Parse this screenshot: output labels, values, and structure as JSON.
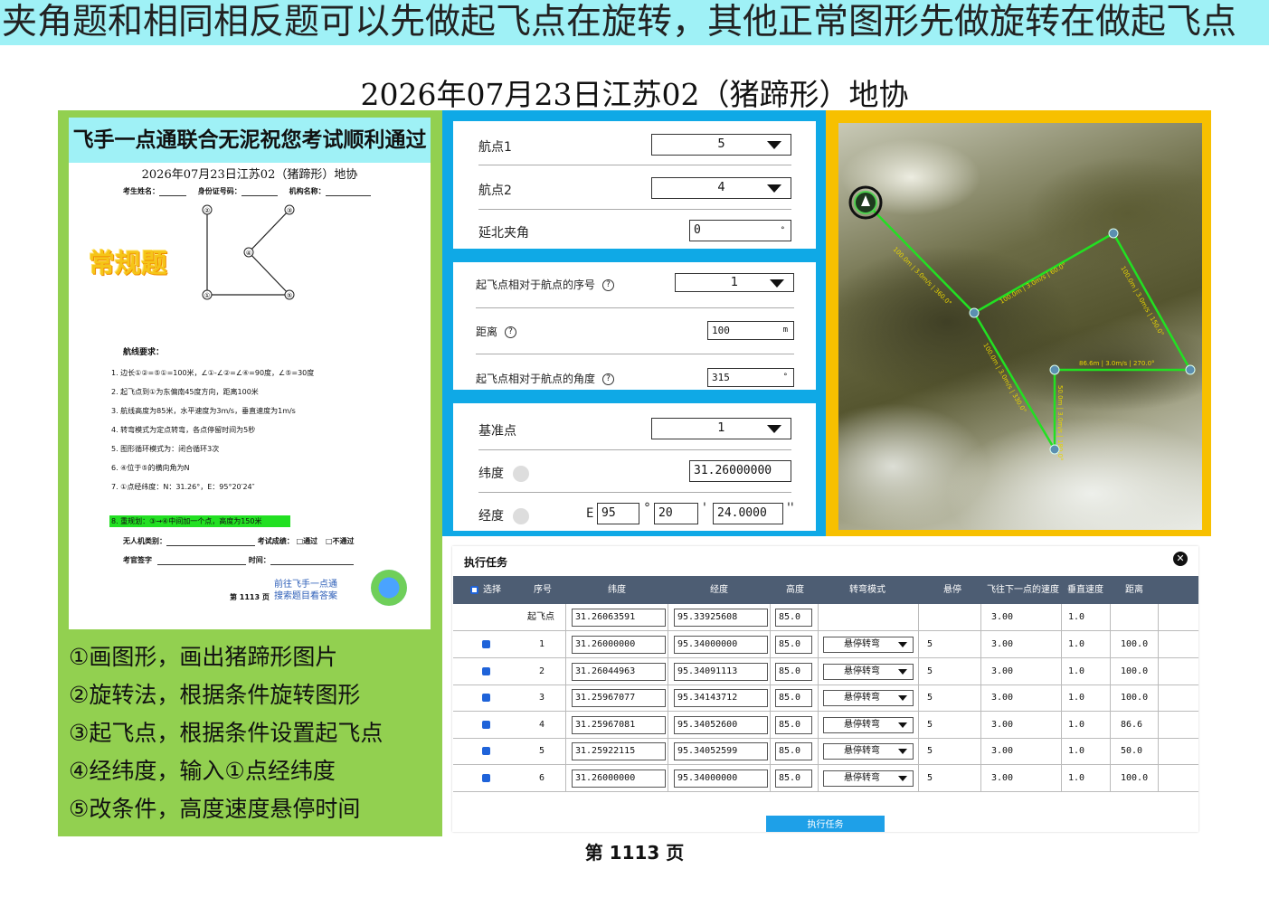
{
  "banner_text": "夹角题和相同相反题可以先做起飞点在旋转，其他正常图形先做旋转在做起飞点",
  "main_title": "2026年07月23日江苏02（猪蹄形）地协",
  "paper": {
    "header": "飞手一点通联合无泥祝您考试顺利通过",
    "title": "2026年07月23日江苏02（猪蹄形）地协",
    "field_name": "考生姓名：",
    "field_id": "身份证号码：",
    "field_org": "机构名称：",
    "routine_label": "常规题",
    "points": [
      "①",
      "②",
      "③",
      "④",
      "⑤"
    ],
    "req_title": "航线要求：",
    "requirements": [
      "1.  边长①②=⑤①=100米，∠①-∠②=∠④=90度，∠⑤=30度",
      "2.  起飞点到①为东偏南45度方向，距离100米",
      "3.  航线高度为85米，水平速度为3m/s，垂直速度为1m/s",
      "4.  转弯模式为定点转弯，各点停留时间为5秒",
      "5.  图形循环模式为：闭合循环3次",
      "6.  ④位于⑤的横向角为N",
      "7.  ①点经纬度：N：31.26°，E：95°20′24″"
    ],
    "req_highlight": "8.  重规划：③→④中间加一个点，高度为150米",
    "uav_type": "无人机类别：",
    "score_label": "考试成绩：",
    "pass": "□通过",
    "fail": "□不通过",
    "examiner": "考官签字",
    "time_label": "时间：",
    "link_line1": "前往飞手一点通",
    "link_line2": "搜索题目看答案",
    "page": "第 1113 页"
  },
  "steps": [
    "①画图形，画出猪蹄形图片",
    "②旋转法，根据条件旋转图形",
    "③起飞点，根据条件设置起飞点",
    "④经纬度，输入①点经纬度",
    "⑤改条件，高度速度悬停时间"
  ],
  "card1": {
    "wp1_label": "航点1",
    "wp1_value": "5",
    "wp2_label": "航点2",
    "wp2_value": "4",
    "angle_label": "延北夹角",
    "angle_value": "0",
    "angle_unit": "°"
  },
  "card2": {
    "seq_label": "起飞点相对于航点的序号",
    "seq_value": "1",
    "dist_label": "距离",
    "dist_value": "100",
    "dist_unit": "m",
    "ang_label": "起飞点相对于航点的角度",
    "ang_value": "315",
    "ang_unit": "°"
  },
  "card3": {
    "base_label": "基准点",
    "base_value": "1",
    "lat_label": "纬度",
    "lat_value": "31.26000000",
    "lon_label": "经度",
    "lon_prefix": "E",
    "lon_deg": "95",
    "lon_min": "20",
    "lon_sec": "24.0000",
    "deg_sym": "°",
    "min_sym": "'",
    "sec_sym": "''"
  },
  "map": {
    "labels": [
      "100.0m | 3.0m/s | 360.0°",
      "100.0m | 3.0m/s | 60.0°",
      "100.0m | 3.0m/s | 150.0°",
      "86.6m | 3.0m/s | 270.0°",
      "50.0m | 3.0m/s | 180.0°",
      "100.0m | 3.0m/s | 330.0°"
    ]
  },
  "task": {
    "title": "执行任务",
    "close": "✕",
    "headers": [
      "选择",
      "序号",
      "纬度",
      "经度",
      "高度",
      "转弯模式",
      "悬停",
      "飞往下一点的速度",
      "垂直速度",
      "距离"
    ],
    "takeoff": {
      "label": "起飞点",
      "lat": "31.26063591",
      "lon": "95.33925608",
      "alt": "85.0",
      "speed": "3.00",
      "vspeed": "1.0"
    },
    "rows": [
      {
        "seq": "1",
        "lat": "31.26000000",
        "lon": "95.34000000",
        "alt": "85.0",
        "mode": "悬停转弯",
        "hover": "5",
        "speed": "3.00",
        "vspeed": "1.0",
        "dist": "100.0"
      },
      {
        "seq": "2",
        "lat": "31.26044963",
        "lon": "95.34091113",
        "alt": "85.0",
        "mode": "悬停转弯",
        "hover": "5",
        "speed": "3.00",
        "vspeed": "1.0",
        "dist": "100.0"
      },
      {
        "seq": "3",
        "lat": "31.25967077",
        "lon": "95.34143712",
        "alt": "85.0",
        "mode": "悬停转弯",
        "hover": "5",
        "speed": "3.00",
        "vspeed": "1.0",
        "dist": "100.0"
      },
      {
        "seq": "4",
        "lat": "31.25967081",
        "lon": "95.34052600",
        "alt": "85.0",
        "mode": "悬停转弯",
        "hover": "5",
        "speed": "3.00",
        "vspeed": "1.0",
        "dist": "86.6"
      },
      {
        "seq": "5",
        "lat": "31.25922115",
        "lon": "95.34052599",
        "alt": "85.0",
        "mode": "悬停转弯",
        "hover": "5",
        "speed": "3.00",
        "vspeed": "1.0",
        "dist": "50.0"
      },
      {
        "seq": "6",
        "lat": "31.26000000",
        "lon": "95.34000000",
        "alt": "85.0",
        "mode": "悬停转弯",
        "hover": "5",
        "speed": "3.00",
        "vspeed": "1.0",
        "dist": "100.0"
      }
    ],
    "exec_button": "执行任务"
  },
  "footer_page": "第 1113 页",
  "colors": {
    "banner": "#9ff1f6",
    "green": "#92d050",
    "blue": "#0fa9e6",
    "gold": "#f7c000",
    "route": "#22e022"
  }
}
